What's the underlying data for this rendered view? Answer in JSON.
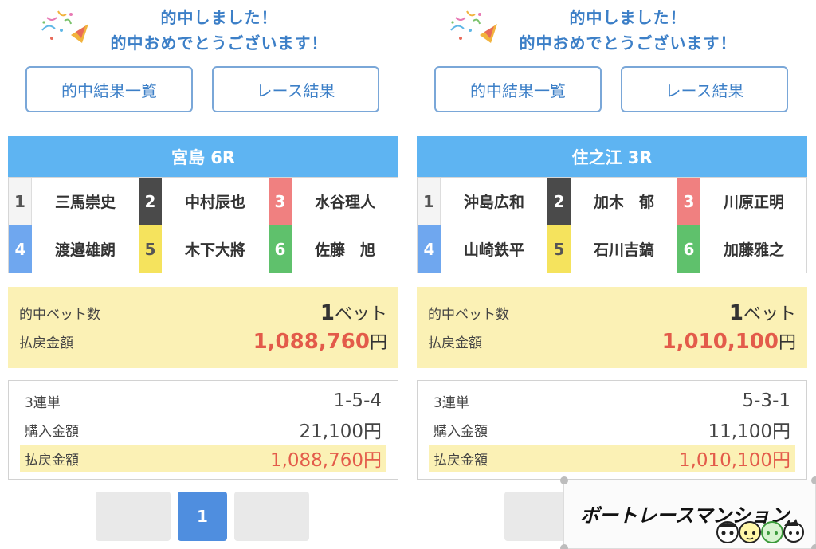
{
  "congrats": {
    "line1": "的中しました！",
    "line2": "的中おめでとうございます！"
  },
  "buttons": {
    "hit_list": "的中結果一覧",
    "race_result": "レース結果"
  },
  "panels": [
    {
      "race": "宮島 6R",
      "entries": [
        {
          "num": "1",
          "name": "三馬崇史"
        },
        {
          "num": "2",
          "name": "中村辰也"
        },
        {
          "num": "3",
          "name": "水谷理人"
        },
        {
          "num": "4",
          "name": "渡邉雄朗"
        },
        {
          "num": "5",
          "name": "木下大將"
        },
        {
          "num": "6",
          "name": "佐藤　旭"
        }
      ],
      "summary": {
        "bets_label": "的中ベット数",
        "bets_value": "1",
        "bets_unit": "ベット",
        "payout_label": "払戻金額",
        "payout_value": "1,088,760",
        "payout_unit": "円"
      },
      "detail": {
        "type_label": "3連単",
        "combo": "1-5-4",
        "purchase_label": "購入金額",
        "purchase_value": "21,100円",
        "payout_label": "払戻金額",
        "payout_value": "1,088,760円"
      }
    },
    {
      "race": "住之江 3R",
      "entries": [
        {
          "num": "1",
          "name": "沖島広和"
        },
        {
          "num": "2",
          "name": "加木　郁"
        },
        {
          "num": "3",
          "name": "川原正明"
        },
        {
          "num": "4",
          "name": "山崎鉄平"
        },
        {
          "num": "5",
          "name": "石川吉鎬"
        },
        {
          "num": "6",
          "name": "加藤雅之"
        }
      ],
      "summary": {
        "bets_label": "的中ベット数",
        "bets_value": "1",
        "bets_unit": "ベット",
        "payout_label": "払戻金額",
        "payout_value": "1,010,100",
        "payout_unit": "円"
      },
      "detail": {
        "type_label": "3連単",
        "combo": "5-3-1",
        "purchase_label": "購入金額",
        "purchase_value": "11,100円",
        "payout_label": "払戻金額",
        "payout_value": "1,010,100円"
      }
    }
  ],
  "pager": {
    "current_page": "1"
  },
  "watermark": {
    "text": "ボートレースマンション"
  },
  "colors": {
    "accent_blue": "#3c7fc7",
    "header_blue": "#5eb4f2",
    "highlight_yellow": "#fbf1b5",
    "payout_red": "#e35b4a",
    "pager_blue": "#4f8edf"
  }
}
